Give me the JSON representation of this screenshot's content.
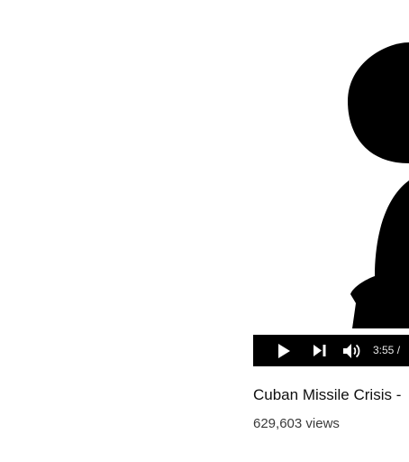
{
  "video": {
    "title": "Cuban Missile Crisis -",
    "views": "629,603 views",
    "player": {
      "time_display": "3:55 /",
      "progress_fraction": 1.0,
      "controls": {
        "play_icon": "play-icon",
        "next_icon": "next-icon",
        "volume_icon": "volume-icon"
      }
    }
  },
  "colors": {
    "controls_bg": "#000000",
    "control_fg": "#ffffff",
    "title_text": "#0f0f0f",
    "views_text": "#3a3a3a"
  }
}
